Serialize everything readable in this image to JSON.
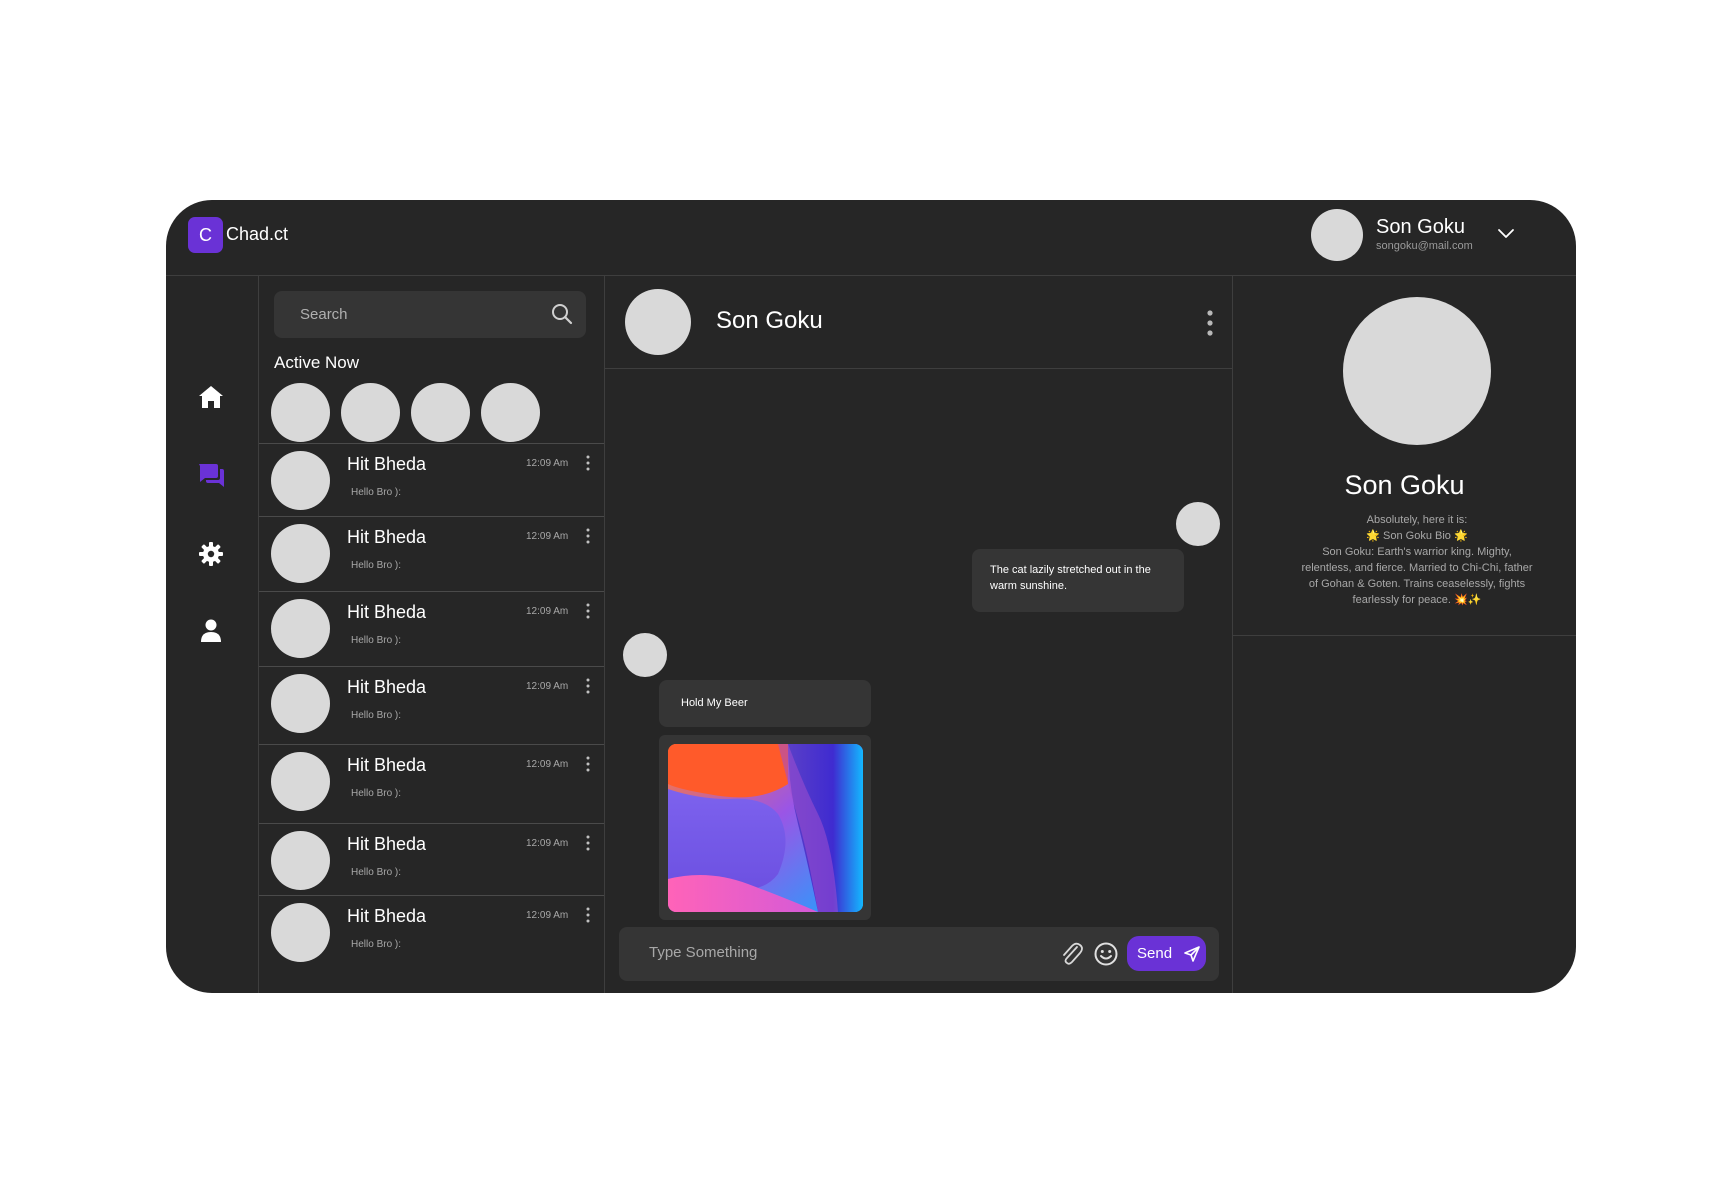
{
  "app": {
    "logo_letter": "C",
    "name": "Chad.ct",
    "accent": "#6a32d6"
  },
  "user": {
    "name": "Son Goku",
    "email": "songoku@mail.com"
  },
  "nav": [
    "home-icon",
    "chat-icon",
    "gear-icon",
    "user-icon"
  ],
  "search": {
    "placeholder": "Search"
  },
  "active_now": {
    "title": "Active Now",
    "count": 4
  },
  "conversations": [
    {
      "name": "Hit Bheda",
      "time": "12:09 Am",
      "message": "Hello Bro ):"
    },
    {
      "name": "Hit Bheda",
      "time": "12:09 Am",
      "message": "Hello Bro ):"
    },
    {
      "name": "Hit Bheda",
      "time": "12:09 Am",
      "message": "Hello Bro ):"
    },
    {
      "name": "Hit Bheda",
      "time": "12:09 Am",
      "message": "Hello Bro ):"
    },
    {
      "name": "Hit Bheda",
      "time": "12:09 Am",
      "message": "Hello Bro ):"
    },
    {
      "name": "Hit Bheda",
      "time": "12:09 Am",
      "message": "Hello Bro ):"
    },
    {
      "name": "Hit Bheda",
      "time": "12:09 Am",
      "message": "Hello Bro ):"
    }
  ],
  "chat": {
    "contact_name": "Son Goku",
    "messages": [
      {
        "side": "right",
        "text": "The cat lazily stretched out in the warm sunshine."
      },
      {
        "side": "left",
        "text": "Hold My Beer"
      }
    ],
    "composer_placeholder": "Type Something",
    "send_label": "Send"
  },
  "profile": {
    "name": "Son Goku",
    "bio_lines": [
      "Absolutely, here it is:",
      "🌟 Son Goku Bio 🌟",
      "Son Goku: Earth's warrior king. Mighty,",
      "relentless, and fierce. Married to Chi-Chi, father",
      "of Gohan & Goten. Trains ceaselessly, fights",
      "fearlessly for peace. 💥✨"
    ]
  }
}
